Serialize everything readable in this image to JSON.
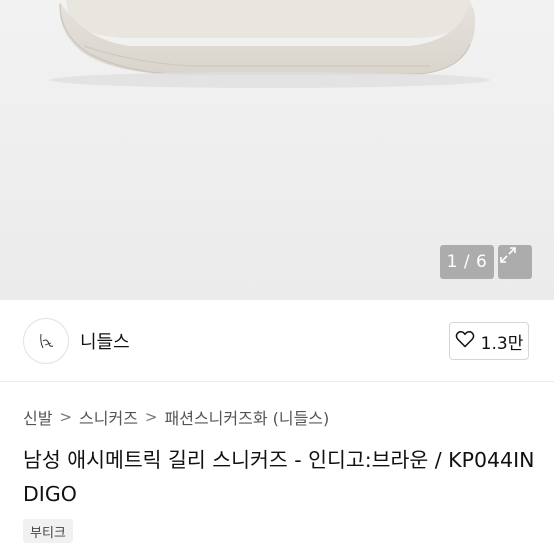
{
  "gallery": {
    "counter": "1 / 6",
    "expand_icon": "expand-icon"
  },
  "shop": {
    "name": "니들스",
    "likes": "1.3만",
    "heart_icon": "heart-outline-icon"
  },
  "breadcrumb": {
    "items": [
      "신발",
      "스니커즈",
      "패션스니커즈화 (니들스)"
    ],
    "separator": ">"
  },
  "product": {
    "title": "남성 애시메트릭 길리 스니커즈 - 인디고:브라운 / KP044INDIGO",
    "tag": "부티크"
  }
}
